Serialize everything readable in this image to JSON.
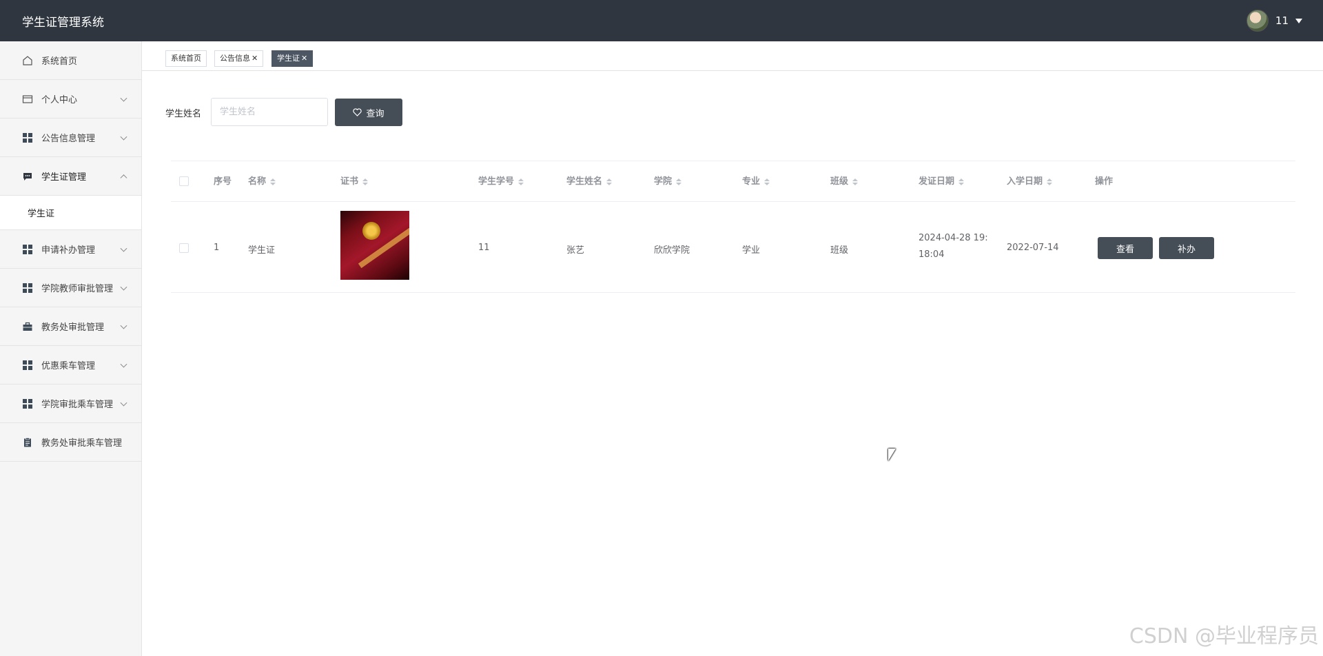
{
  "header": {
    "app_title": "学生证管理系统",
    "username": "11"
  },
  "sidebar": {
    "items": [
      {
        "label": "系统首页",
        "icon": "home-icon",
        "expandable": false
      },
      {
        "label": "个人中心",
        "icon": "card-icon",
        "expandable": true
      },
      {
        "label": "公告信息管理",
        "icon": "grid-icon",
        "expandable": true
      },
      {
        "label": "学生证管理",
        "icon": "message-icon",
        "expandable": true,
        "expanded": true
      },
      {
        "label": "申请补办管理",
        "icon": "grid-icon",
        "expandable": true
      },
      {
        "label": "学院教师审批管理",
        "icon": "grid-icon",
        "expandable": true
      },
      {
        "label": "教务处审批管理",
        "icon": "briefcase-icon",
        "expandable": true
      },
      {
        "label": "优惠乘车管理",
        "icon": "grid-icon",
        "expandable": true
      },
      {
        "label": "学院审批乘车管理",
        "icon": "grid-icon",
        "expandable": true
      },
      {
        "label": "教务处审批乘车管理",
        "icon": "clipboard-icon",
        "expandable": false
      }
    ],
    "submenu": {
      "parent": "学生证管理",
      "items": [
        {
          "label": "学生证",
          "active": true
        }
      ]
    }
  },
  "tabs": [
    {
      "label": "系统首页",
      "closable": false,
      "active": false
    },
    {
      "label": "公告信息",
      "closable": true,
      "active": false
    },
    {
      "label": "学生证",
      "closable": true,
      "active": true
    }
  ],
  "search": {
    "label": "学生姓名",
    "placeholder": "学生姓名",
    "value": "",
    "button_label": "查询"
  },
  "table": {
    "columns": [
      "序号",
      "名称",
      "证书",
      "学生学号",
      "学生姓名",
      "学院",
      "专业",
      "班级",
      "发证日期",
      "入学日期",
      "操作"
    ],
    "rows": [
      {
        "index": "1",
        "name": "学生证",
        "certificate": "image",
        "student_id": "11",
        "student_name": "张艺",
        "college": "欣欣学院",
        "major": "学业",
        "class": "班级",
        "issue_date_line1": "2024-04-28 19:",
        "issue_date_line2": "18:04",
        "enroll_date": "2022-07-14",
        "actions": [
          "查看",
          "补办"
        ]
      }
    ]
  },
  "watermark": "CSDN @毕业程序员",
  "colors": {
    "header_bg": "#2f3640",
    "button_bg": "#454d57",
    "active_tab_bg": "#4d5763",
    "sidebar_bg": "#f5f5f5"
  }
}
